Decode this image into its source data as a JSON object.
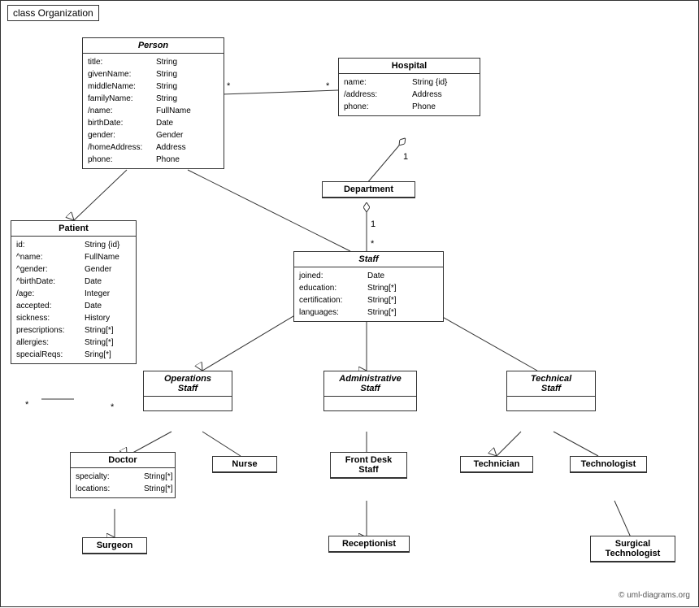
{
  "title": "class Organization",
  "classes": {
    "person": {
      "name": "Person",
      "italic": true,
      "attrs": [
        {
          "name": "title:",
          "type": "String"
        },
        {
          "name": "givenName:",
          "type": "String"
        },
        {
          "name": "middleName:",
          "type": "String"
        },
        {
          "name": "familyName:",
          "type": "String"
        },
        {
          "name": "/name:",
          "type": "FullName"
        },
        {
          "name": "birthDate:",
          "type": "Date"
        },
        {
          "name": "gender:",
          "type": "Gender"
        },
        {
          "name": "/homeAddress:",
          "type": "Address"
        },
        {
          "name": "phone:",
          "type": "Phone"
        }
      ]
    },
    "hospital": {
      "name": "Hospital",
      "italic": false,
      "attrs": [
        {
          "name": "name:",
          "type": "String {id}"
        },
        {
          "name": "/address:",
          "type": "Address"
        },
        {
          "name": "phone:",
          "type": "Phone"
        }
      ]
    },
    "department": {
      "name": "Department",
      "italic": false,
      "attrs": []
    },
    "staff": {
      "name": "Staff",
      "italic": true,
      "attrs": [
        {
          "name": "joined:",
          "type": "Date"
        },
        {
          "name": "education:",
          "type": "String[*]"
        },
        {
          "name": "certification:",
          "type": "String[*]"
        },
        {
          "name": "languages:",
          "type": "String[*]"
        }
      ]
    },
    "patient": {
      "name": "Patient",
      "italic": false,
      "attrs": [
        {
          "name": "id:",
          "type": "String {id}"
        },
        {
          "name": "^name:",
          "type": "FullName"
        },
        {
          "name": "^gender:",
          "type": "Gender"
        },
        {
          "name": "^birthDate:",
          "type": "Date"
        },
        {
          "name": "/age:",
          "type": "Integer"
        },
        {
          "name": "accepted:",
          "type": "Date"
        },
        {
          "name": "sickness:",
          "type": "History"
        },
        {
          "name": "prescriptions:",
          "type": "String[*]"
        },
        {
          "name": "allergies:",
          "type": "String[*]"
        },
        {
          "name": "specialReqs:",
          "type": "Sring[*]"
        }
      ]
    },
    "operations_staff": {
      "name": "Operations\nStaff",
      "italic": true,
      "attrs": []
    },
    "administrative_staff": {
      "name": "Administrative\nStaff",
      "italic": true,
      "attrs": []
    },
    "technical_staff": {
      "name": "Technical\nStaff",
      "italic": true,
      "attrs": []
    },
    "doctor": {
      "name": "Doctor",
      "italic": false,
      "attrs": [
        {
          "name": "specialty:",
          "type": "String[*]"
        },
        {
          "name": "locations:",
          "type": "String[*]"
        }
      ]
    },
    "nurse": {
      "name": "Nurse",
      "italic": false,
      "attrs": []
    },
    "front_desk_staff": {
      "name": "Front Desk\nStaff",
      "italic": false,
      "attrs": []
    },
    "technician": {
      "name": "Technician",
      "italic": false,
      "attrs": []
    },
    "technologist": {
      "name": "Technologist",
      "italic": false,
      "attrs": []
    },
    "surgeon": {
      "name": "Surgeon",
      "italic": false,
      "attrs": []
    },
    "receptionist": {
      "name": "Receptionist",
      "italic": false,
      "attrs": []
    },
    "surgical_technologist": {
      "name": "Surgical\nTechnologist",
      "italic": false,
      "attrs": []
    }
  },
  "copyright": "© uml-diagrams.org"
}
